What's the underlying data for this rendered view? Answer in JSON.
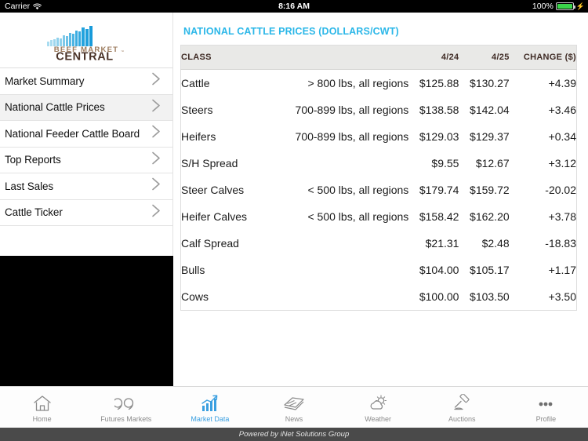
{
  "statusbar": {
    "carrier": "Carrier",
    "wifi_icon": "wifi-icon",
    "time": "8:16 AM",
    "battery_percent": "100%",
    "battery_icon": "battery-full-icon",
    "charging_icon": "lightning-bolt-icon"
  },
  "brand": {
    "logo_icon": "beef-market-central-logo",
    "line1": "BEEF MARKET",
    "line2": "CENTRAL",
    "trademark": "™",
    "bar_color_light": "#9fd8ef",
    "bar_color_dark": "#2bb7e8",
    "text_color_top": "#9b7a5c",
    "text_color_bottom": "#4a3328"
  },
  "sidebar": {
    "items": [
      {
        "label": "Market Summary",
        "selected": false
      },
      {
        "label": "National Cattle Prices",
        "selected": true
      },
      {
        "label": "National Feeder Cattle Board",
        "selected": false
      },
      {
        "label": "Top Reports",
        "selected": false
      },
      {
        "label": "Last Sales",
        "selected": false
      },
      {
        "label": "Cattle Ticker",
        "selected": false
      }
    ],
    "chevron_icon": "chevron-right-icon"
  },
  "main": {
    "title": "NATIONAL CATTLE PRICES (DOLLARS/CWT)",
    "title_color": "#2bb7e8"
  },
  "table": {
    "headers": [
      "CLASS",
      "",
      "4/24",
      "4/25",
      "CHANGE ($)"
    ],
    "rows": [
      {
        "class": "Cattle",
        "sub": "> 800 lbs, all regions",
        "d1": "$125.88",
        "d2": "$130.27",
        "change": "+4.39",
        "dir": "up"
      },
      {
        "class": "Steers",
        "sub": "700-899 lbs, all regions",
        "d1": "$138.58",
        "d2": "$142.04",
        "change": "+3.46",
        "dir": "up"
      },
      {
        "class": "Heifers",
        "sub": "700-899 lbs, all regions",
        "d1": "$129.03",
        "d2": "$129.37",
        "change": "+0.34",
        "dir": "up"
      },
      {
        "class": "S/H Spread",
        "sub": "",
        "d1": "$9.55",
        "d2": "$12.67",
        "change": "+3.12",
        "dir": "up"
      },
      {
        "class": "Steer Calves",
        "sub": "< 500 lbs, all regions",
        "d1": "$179.74",
        "d2": "$159.72",
        "change": "-20.02",
        "dir": "down"
      },
      {
        "class": "Heifer Calves",
        "sub": "< 500 lbs, all regions",
        "d1": "$158.42",
        "d2": "$162.20",
        "change": "+3.78",
        "dir": "up"
      },
      {
        "class": "Calf Spread",
        "sub": "",
        "d1": "$21.31",
        "d2": "$2.48",
        "change": "-18.83",
        "dir": "down"
      },
      {
        "class": "Bulls",
        "sub": "",
        "d1": "$104.00",
        "d2": "$105.17",
        "change": "+1.17",
        "dir": "up"
      },
      {
        "class": "Cows",
        "sub": "",
        "d1": "$100.00",
        "d2": "$103.50",
        "change": "+3.50",
        "dir": "up"
      }
    ],
    "up_color": "#1cb84c",
    "down_color": "#ef3b42"
  },
  "tabbar": {
    "active_color": "#3a9fe0",
    "inactive_color": "#8a8a8a",
    "tabs": [
      {
        "label": "Home",
        "icon": "home-icon",
        "active": false
      },
      {
        "label": "Futures Markets",
        "icon": "quotes-icon",
        "active": false
      },
      {
        "label": "Market Data",
        "icon": "bar-chart-up-icon",
        "active": true
      },
      {
        "label": "News",
        "icon": "newspaper-icon",
        "active": false
      },
      {
        "label": "Weather",
        "icon": "sun-cloud-icon",
        "active": false
      },
      {
        "label": "Auctions",
        "icon": "gavel-icon",
        "active": false
      },
      {
        "label": "Profile",
        "icon": "more-dots-icon",
        "active": false
      }
    ]
  },
  "footer": {
    "text": "Powered by iNet Solutions Group"
  }
}
